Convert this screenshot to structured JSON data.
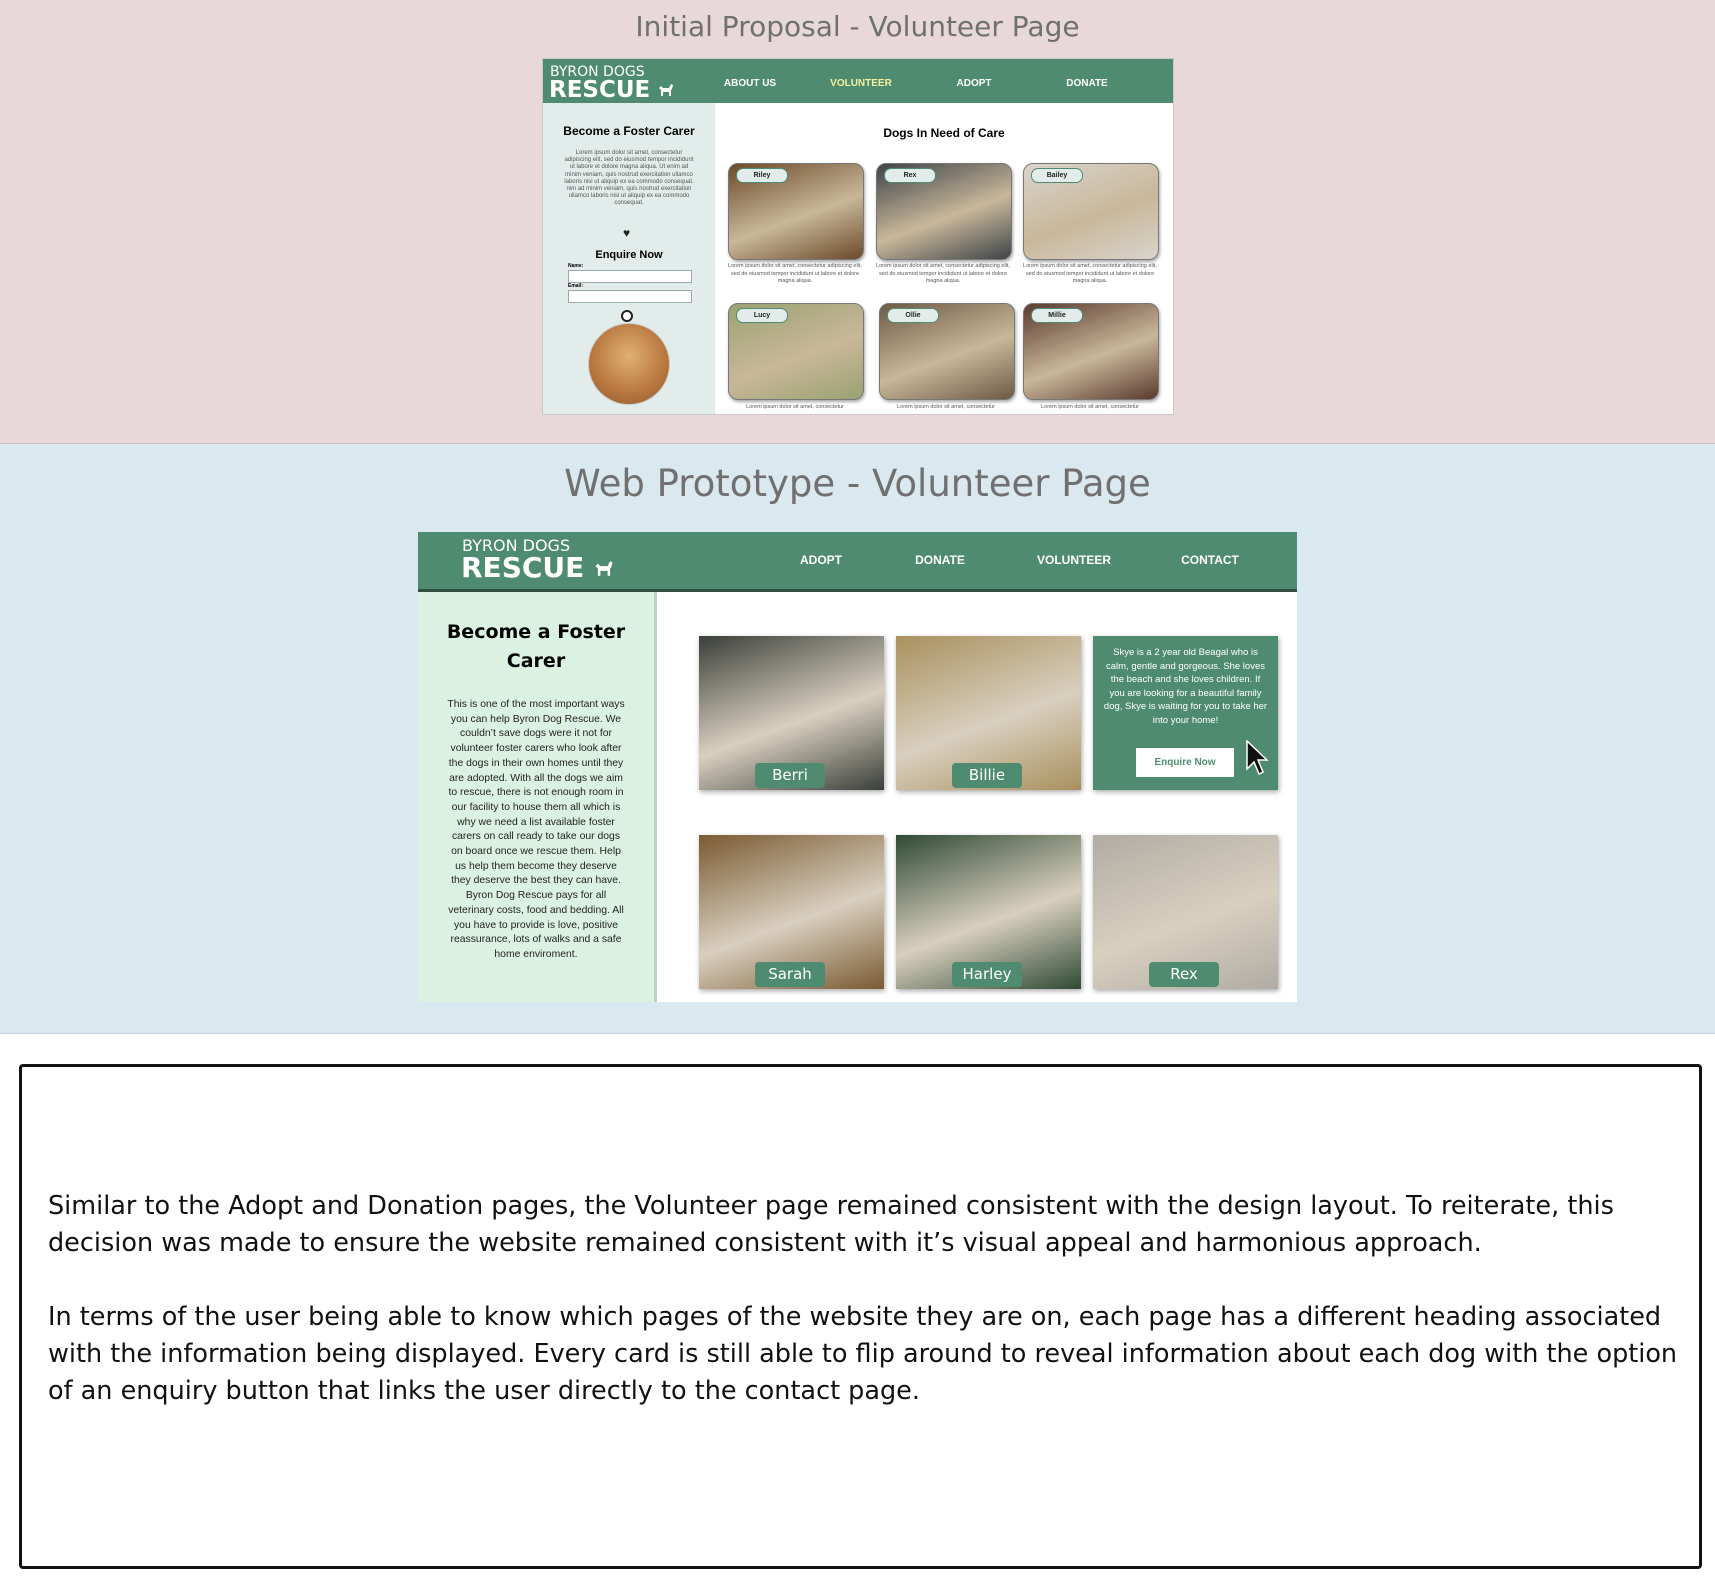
{
  "sections": {
    "proposal_title": "Initial Proposal - Volunteer Page",
    "prototype_title": "Web Prototype - Volunteer Page"
  },
  "proposal": {
    "brand_top": "BYRON DOGS",
    "brand_bottom": "RESCUE",
    "nav": [
      "ABOUT US",
      "VOLUNTEER",
      "ADOPT",
      "DONATE"
    ],
    "active_nav": "VOLUNTEER",
    "sidebar": {
      "heading": "Become a Foster Carer",
      "text": "Lorem ipsum dolor sit amet, consectetur adipiscing elit, sed do eiusmod tempor incididunt ut labore et dolore magna aliqua. Ut enim ad minim veniam, quis nostrud exercitation ullamco laboris nisi ut aliquip ex ea commodo consequat. nim ad minim veniam, quis nostrud exercitation ullamco laboris nisi ut aliquip ex ea commodo consequat.",
      "enquire_heading": "Enquire Now",
      "name_label": "Name:",
      "email_label": "Email:"
    },
    "main_heading": "Dogs In Need of Care",
    "card_text": "Lorem ipsum dolor sit amet, consectetur adipiscing elit, sed do eiusmod tempor incididunt ut labore et dolore magna aliqua.",
    "card_text_short": "Lorem ipsum dolor sit amet, consectetur",
    "dogs": [
      {
        "name": "Riley",
        "color": "#6b4a2a"
      },
      {
        "name": "Rex",
        "color": "#3e4448"
      },
      {
        "name": "Bailey",
        "color": "#d9d4cc"
      },
      {
        "name": "Lucy",
        "color": "#9aa272"
      },
      {
        "name": "Ollie",
        "color": "#6d5a45"
      },
      {
        "name": "Millie",
        "color": "#5a3a2e"
      }
    ]
  },
  "prototype": {
    "brand_top": "BYRON DOGS",
    "brand_bottom": "RESCUE",
    "nav": [
      "ADOPT",
      "DONATE",
      "VOLUNTEER",
      "CONTACT"
    ],
    "sidebar": {
      "heading": "Become a Foster Carer",
      "text": "This is one of the most important ways you can help Byron Dog Rescue. We couldn’t save dogs were it not for volunteer foster carers who look after the dogs in their own homes until they are adopted. With all the dogs we aim to rescue, there is not enough room in our facility to house them all which is why we need a list available foster carers on call ready to take our dogs on board once we rescue them. Help us help them become they deserve they deserve the best they can have. Byron Dog Rescue pays for all veterinary costs, food and bedding. All you have to provide is love, positive reassurance, lots of walks and a safe home enviroment."
    },
    "dogs": [
      {
        "name": "Berri",
        "color": "#3a3f3a"
      },
      {
        "name": "Billie",
        "color": "#a9915e"
      },
      {
        "name": "Sarah",
        "color": "#7a5a32"
      },
      {
        "name": "Harley",
        "color": "#2f4a33"
      },
      {
        "name": "Rex",
        "color": "#b0aca4"
      }
    ],
    "flip_card": {
      "text": "Skye is a 2 year old Beagal who is calm, gentle and gorgeous. She loves the beach and she loves children. If you are looking for a beautiful family dog, Skye is waiting for you to take her into your home!",
      "button": "Enquire Now"
    }
  },
  "description": {
    "paragraph1": "Similar to the Adopt and Donation pages, the Volunteer page remained consistent with the design layout. To reiterate, this decision was made to ensure the website remained consistent with it’s visual appeal and harmonious approach.",
    "paragraph2": "In terms of the user being able to know which pages of the website they are on, each page has a different heading associated with the information being displayed.  Every card is still able to flip around to reveal information about each dog with the option of an enquiry button that links the user directly to the contact page."
  },
  "colors": {
    "brand_green": "#4f8b70",
    "active_nav": "#f4f1a0",
    "proposal_band": "#e8d8da",
    "prototype_band": "#dae8ef"
  }
}
